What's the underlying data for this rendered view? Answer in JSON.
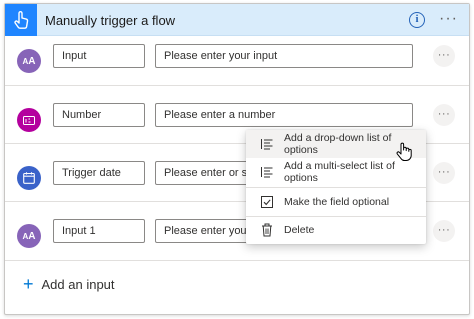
{
  "header": {
    "title": "Manually trigger a flow",
    "info_icon": "info-icon",
    "more_icon": "more-icon",
    "trigger_icon": "touch-icon"
  },
  "inputs": [
    {
      "type": "text",
      "icon": "AA",
      "icon_color": "#8764b8",
      "name": "Input",
      "placeholder": "Please enter your input"
    },
    {
      "type": "number",
      "icon": "123",
      "icon_color": "#b4009e",
      "name": "Number",
      "placeholder": "Please enter a number"
    },
    {
      "type": "date",
      "icon": "calendar",
      "icon_color": "#3a62c9",
      "name": "Trigger date",
      "placeholder": "Please enter or select a date"
    },
    {
      "type": "text",
      "icon": "AA",
      "icon_color": "#8764b8",
      "name": "Input 1",
      "placeholder": "Please enter your input"
    }
  ],
  "context_menu": {
    "items": [
      {
        "label": "Add a drop-down list of options",
        "icon": "list-icon"
      },
      {
        "label": "Add a multi-select list of options",
        "icon": "list-icon"
      },
      {
        "label": "Make the field optional",
        "icon": "checkbox-icon"
      },
      {
        "label": "Delete",
        "icon": "trash-icon"
      }
    ]
  },
  "add_input": {
    "label": "Add an input",
    "icon": "plus-icon"
  },
  "colors": {
    "accent": "#1f85ff",
    "header_bg": "#d9ecfb",
    "link": "#0078d4"
  }
}
